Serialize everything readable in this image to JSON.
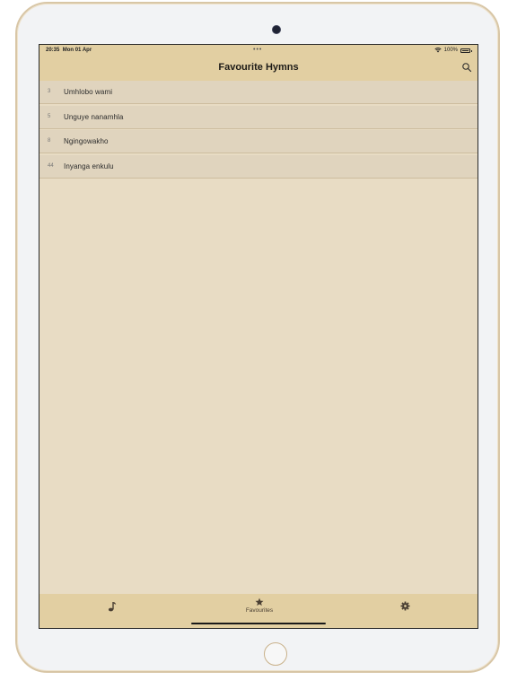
{
  "status_bar": {
    "time": "20:35",
    "date": "Mon 01 Apr",
    "dots": "•••",
    "battery": "100%"
  },
  "nav": {
    "title": "Favourite Hymns",
    "search_icon": "search-icon"
  },
  "hymns": [
    {
      "number": "3",
      "title": "Umhlobo wami"
    },
    {
      "number": "5",
      "title": "Unguye nanamhla"
    },
    {
      "number": "8",
      "title": "Ngingowakho"
    },
    {
      "number": "44",
      "title": "Inyanga enkulu"
    }
  ],
  "tabs": [
    {
      "icon": "music-note-icon",
      "label": ""
    },
    {
      "icon": "star-icon",
      "label": "Favourites"
    },
    {
      "icon": "gear-icon",
      "label": ""
    }
  ],
  "colors": {
    "bar": "#e2cfa2",
    "background": "#e8dcc4",
    "row": "#e0d4be"
  }
}
